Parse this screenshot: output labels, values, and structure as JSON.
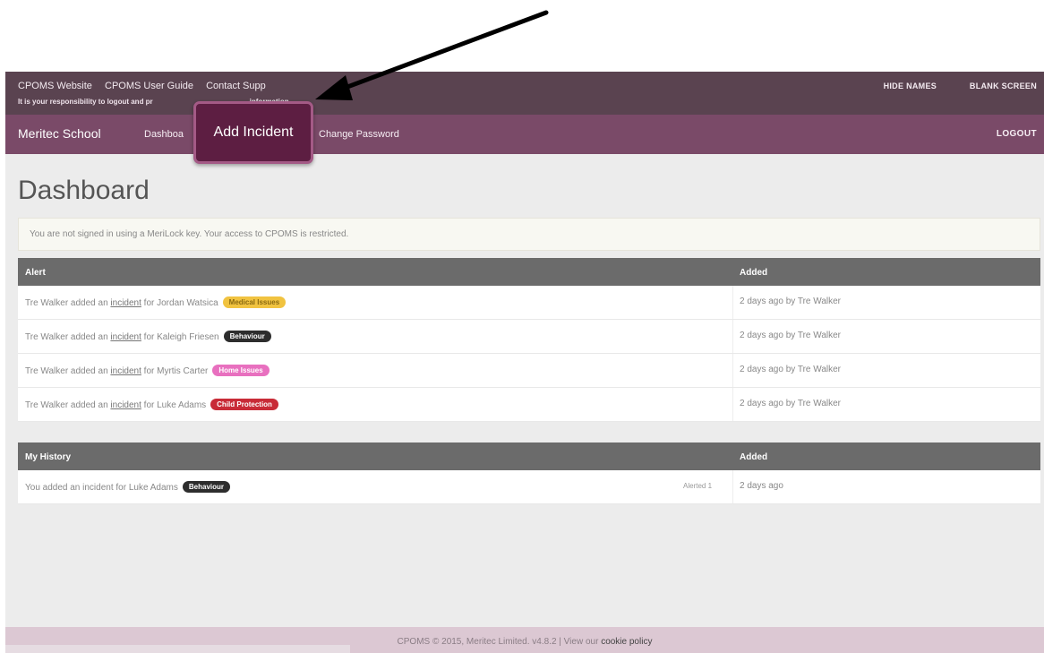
{
  "topbar": {
    "links": [
      "CPOMS Website",
      "CPOMS User Guide",
      "Contact Supp"
    ],
    "notice": "It is your responsibility to logout and pr",
    "notice_tail": "information.",
    "hide_names": "HIDE NAMES",
    "blank_screen": "BLANK SCREEN"
  },
  "nav": {
    "school": "Meritec School",
    "dashboard": "Dashboa",
    "add_incident": "Add Incident",
    "change_password": "Change Password",
    "logout": "LOGOUT"
  },
  "page": {
    "title": "Dashboard",
    "warning": "You are not signed in using a MeriLock key. Your access to CPOMS is restricted."
  },
  "alerts": {
    "col_alert": "Alert",
    "col_added": "Added",
    "rows": [
      {
        "prefix": "Tre Walker added an",
        "link": "incident",
        "suffix": "for Jordan Watsica",
        "badge": "Medical Issues",
        "added": "2 days ago by Tre Walker"
      },
      {
        "prefix": "Tre Walker added an",
        "link": "incident",
        "suffix": "for Kaleigh Friesen",
        "badge": "Behaviour",
        "added": "2 days ago by Tre Walker"
      },
      {
        "prefix": "Tre Walker added an",
        "link": "incident",
        "suffix": "for Myrtis Carter",
        "badge": "Home Issues",
        "added": "2 days ago by Tre Walker"
      },
      {
        "prefix": "Tre Walker added an",
        "link": "incident",
        "suffix": "for Luke Adams",
        "badge": "Child Protection",
        "added": "2 days ago by Tre Walker"
      }
    ]
  },
  "history": {
    "col_title": "My History",
    "col_added": "Added",
    "rows": [
      {
        "text": "You added an incident for Luke Adams",
        "badge": "Behaviour",
        "alerted": "Alerted 1",
        "added": "2 days ago"
      }
    ]
  },
  "footer": {
    "text": "CPOMS © 2015, Meritec Limited. v4.8.2 | View our",
    "cookie": "cookie policy"
  },
  "colors": {
    "topbar": "#5a4350",
    "navbar": "#7a4a68",
    "callout": "#5d1e42",
    "medical": "#f1c340",
    "behaviour": "#2d2d2d",
    "home": "#e870bf",
    "child_protection": "#c82b37"
  },
  "icons": {
    "pointer": "arrow-icon"
  }
}
